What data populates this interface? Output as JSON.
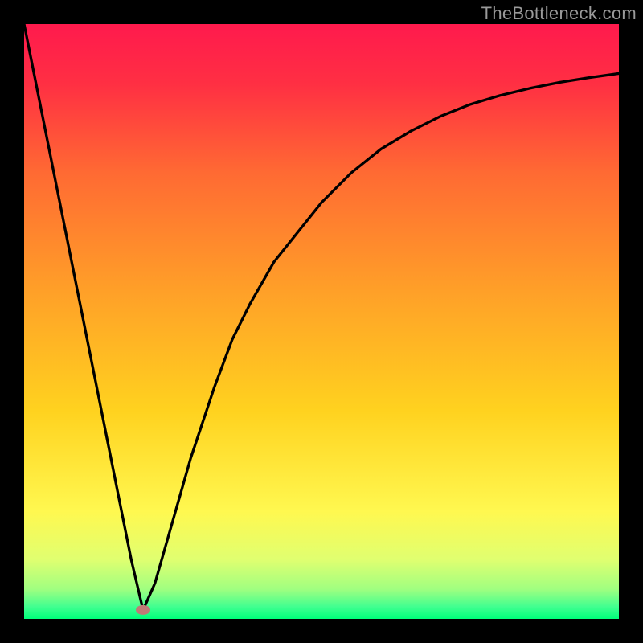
{
  "watermark": "TheBottleneck.com",
  "gradient": {
    "stops": [
      {
        "offset": 0.0,
        "color": "#ff1a4d"
      },
      {
        "offset": 0.1,
        "color": "#ff2f43"
      },
      {
        "offset": 0.25,
        "color": "#ff6a33"
      },
      {
        "offset": 0.45,
        "color": "#ffa028"
      },
      {
        "offset": 0.65,
        "color": "#ffd21f"
      },
      {
        "offset": 0.82,
        "color": "#fff850"
      },
      {
        "offset": 0.9,
        "color": "#e0ff70"
      },
      {
        "offset": 0.95,
        "color": "#a0ff80"
      },
      {
        "offset": 0.98,
        "color": "#40ff90"
      },
      {
        "offset": 1.0,
        "color": "#00ff7a"
      }
    ]
  },
  "chart_data": {
    "type": "line",
    "xlim": [
      0,
      100
    ],
    "ylim": [
      0,
      100
    ],
    "curve_minimum_x": 20,
    "marker": {
      "x": 20,
      "y": 1.5,
      "color": "#c07a76"
    },
    "x": [
      0,
      2,
      4,
      6,
      8,
      10,
      12,
      14,
      16,
      18,
      20,
      22,
      24,
      26,
      28,
      30,
      32,
      35,
      38,
      42,
      46,
      50,
      55,
      60,
      65,
      70,
      75,
      80,
      85,
      90,
      95,
      100
    ],
    "y": [
      100,
      90,
      80,
      70,
      60,
      50,
      40,
      30,
      20,
      10,
      1.5,
      6,
      13,
      20,
      27,
      33,
      39,
      47,
      53,
      60,
      65,
      70,
      75,
      79,
      82,
      84.5,
      86.5,
      88,
      89.2,
      90.2,
      91,
      91.7
    ]
  }
}
